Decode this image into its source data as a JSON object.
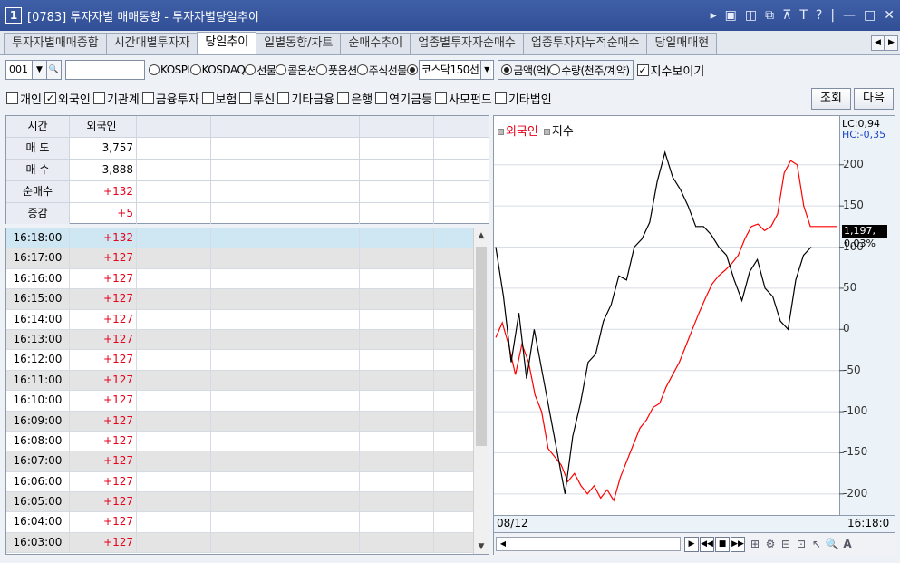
{
  "window": {
    "num": "1",
    "title": "[0783] 투자자별 매매동향 - 투자자별당일추이",
    "icons": [
      "arrow-right-icon",
      "screen-icon",
      "window-icon",
      "copy-icon",
      "pin-icon",
      "font-icon",
      "help-icon",
      "minimize-icon",
      "maximize-icon",
      "close-icon"
    ]
  },
  "tabs": [
    {
      "label": "투자자별매매종합",
      "active": false
    },
    {
      "label": "시간대별투자자",
      "active": false
    },
    {
      "label": "당일추이",
      "active": true
    },
    {
      "label": "일별동향/차트",
      "active": false
    },
    {
      "label": "순매수추이",
      "active": false
    },
    {
      "label": "업종별투자자순매수",
      "active": false
    },
    {
      "label": "업종투자자누적순매수",
      "active": false
    },
    {
      "label": "당일매매현",
      "active": false
    }
  ],
  "toolbar": {
    "code": "001",
    "name": "",
    "markets": [
      "KOSPI",
      "KOSDAQ",
      "선물",
      "콜옵션",
      "풋옵션",
      "주식선물",
      "코스닥150선"
    ],
    "units": [
      "금액(억)",
      "수량(천주/계약)"
    ],
    "show_index": "지수보이기"
  },
  "filters": [
    {
      "label": "개인",
      "checked": false
    },
    {
      "label": "외국인",
      "checked": true
    },
    {
      "label": "기관계",
      "checked": false
    },
    {
      "label": "금융투자",
      "checked": false
    },
    {
      "label": "보험",
      "checked": false
    },
    {
      "label": "투신",
      "checked": false
    },
    {
      "label": "기타금융",
      "checked": false
    },
    {
      "label": "은행",
      "checked": false
    },
    {
      "label": "연기금등",
      "checked": false
    },
    {
      "label": "사모펀드",
      "checked": false
    },
    {
      "label": "기타법인",
      "checked": false
    }
  ],
  "buttons": {
    "query": "조회",
    "next": "다음"
  },
  "summary": {
    "header": [
      "시간",
      "외국인"
    ],
    "rows": [
      {
        "label": "매 도",
        "value": "3,757",
        "red": false
      },
      {
        "label": "매 수",
        "value": "3,888",
        "red": false
      },
      {
        "label": "순매수",
        "value": "+132",
        "red": true
      },
      {
        "label": "증감",
        "value": "+5",
        "red": true
      }
    ]
  },
  "list": [
    {
      "time": "16:18:00",
      "value": "+132"
    },
    {
      "time": "16:17:00",
      "value": "+127"
    },
    {
      "time": "16:16:00",
      "value": "+127"
    },
    {
      "time": "16:15:00",
      "value": "+127"
    },
    {
      "time": "16:14:00",
      "value": "+127"
    },
    {
      "time": "16:13:00",
      "value": "+127"
    },
    {
      "time": "16:12:00",
      "value": "+127"
    },
    {
      "time": "16:11:00",
      "value": "+127"
    },
    {
      "time": "16:10:00",
      "value": "+127"
    },
    {
      "time": "16:09:00",
      "value": "+127"
    },
    {
      "time": "16:08:00",
      "value": "+127"
    },
    {
      "time": "16:07:00",
      "value": "+127"
    },
    {
      "time": "16:06:00",
      "value": "+127"
    },
    {
      "time": "16:05:00",
      "value": "+127"
    },
    {
      "time": "16:04:00",
      "value": "+127"
    },
    {
      "time": "16:03:00",
      "value": "+127"
    }
  ],
  "chart_data": {
    "type": "line",
    "legend": [
      "외국인",
      "지수"
    ],
    "y_ticks": [
      200,
      150,
      100,
      50,
      0,
      -50,
      -100,
      -150,
      -200
    ],
    "ylim": [
      -220,
      235
    ],
    "lc": "LC:0,94",
    "hc": "HC:-0,35",
    "current_index": "1,197,",
    "current_pct": "0,03%",
    "x_start": "08/12",
    "x_end": "16:18:0",
    "colors": {
      "foreign": "#ff0000",
      "index": "#000000"
    },
    "series": [
      {
        "name": "외국인",
        "values": [
          -10,
          8,
          -20,
          -55,
          -18,
          -40,
          -80,
          -100,
          -145,
          -155,
          -165,
          -185,
          -175,
          -190,
          -200,
          -190,
          -205,
          -195,
          -208,
          -180,
          -160,
          -140,
          -120,
          -110,
          -95,
          -90,
          -70,
          -55,
          -40,
          -20,
          0,
          20,
          38,
          55,
          65,
          72,
          80,
          90,
          110,
          125,
          128,
          120,
          125,
          140,
          190,
          205,
          200,
          150,
          125,
          125,
          125,
          125,
          125
        ]
      },
      {
        "name": "지수",
        "values": [
          100,
          40,
          -40,
          20,
          -60,
          0,
          -50,
          -100,
          -150,
          -200,
          -130,
          -90,
          -40,
          -30,
          10,
          30,
          65,
          60,
          100,
          110,
          130,
          180,
          215,
          185,
          170,
          150,
          125,
          125,
          115,
          100,
          90,
          60,
          35,
          70,
          85,
          50,
          40,
          10,
          0,
          60,
          90,
          100
        ]
      }
    ]
  }
}
